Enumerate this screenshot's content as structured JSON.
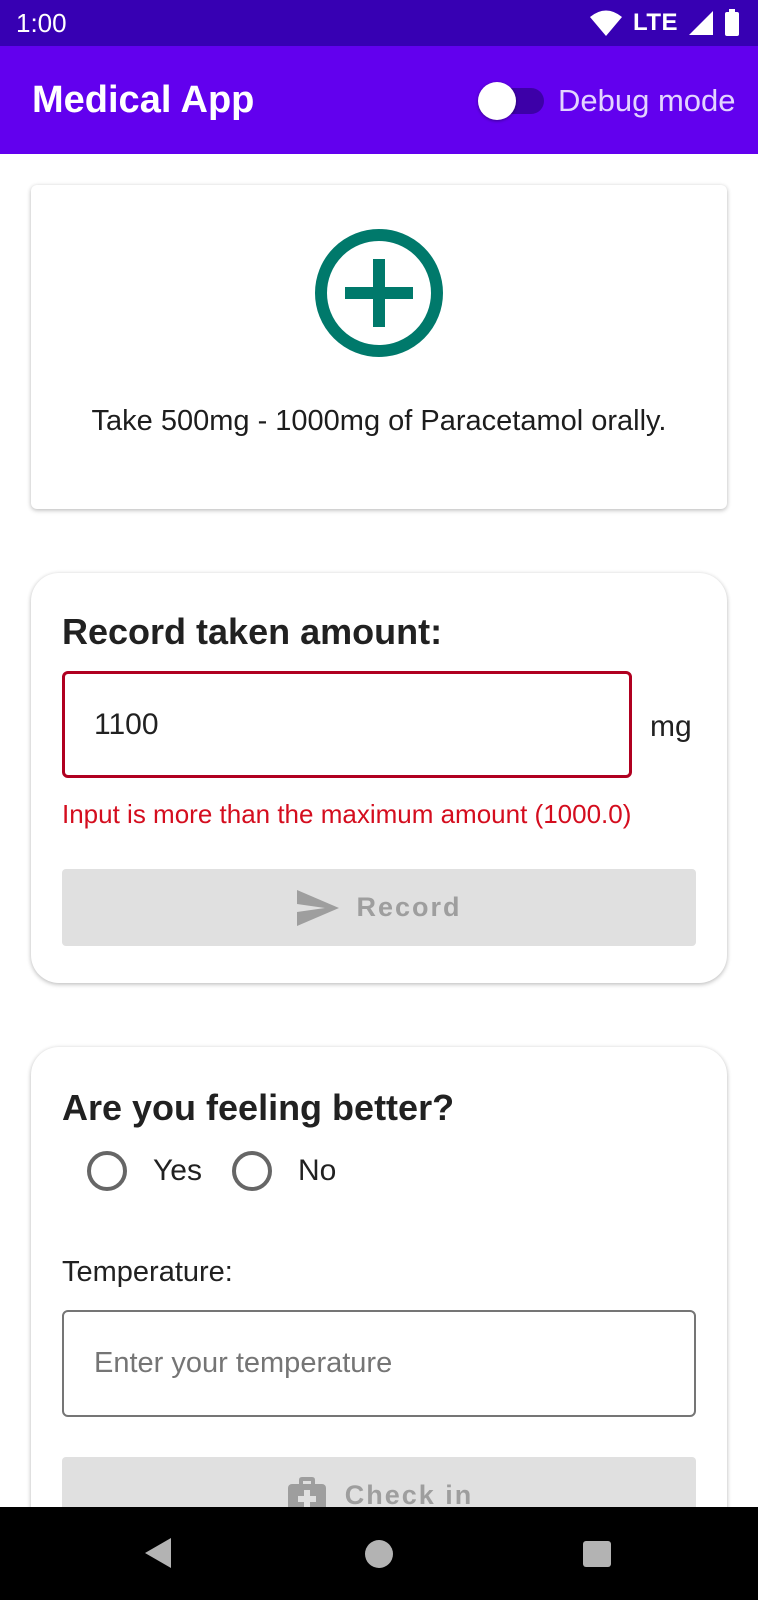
{
  "status_bar": {
    "time": "1:00",
    "network": "LTE",
    "icons": [
      "wifi-icon",
      "signal-icon",
      "battery-icon"
    ]
  },
  "app_bar": {
    "title": "Medical App",
    "debug_label": "Debug mode",
    "debug_enabled": false,
    "color": "#6200ee"
  },
  "instruction_card": {
    "icon": "add-circle-icon",
    "icon_color": "#00796b",
    "text": "Take 500mg - 1000mg of Paracetamol orally."
  },
  "record_card": {
    "title": "Record taken amount:",
    "amount_value": "1100",
    "unit": "mg",
    "error": "Input is more than the maximum amount (1000.0)",
    "error_color": "#d40d1e",
    "button_label": "Record",
    "button_icon": "send-icon",
    "button_enabled": false
  },
  "feeling_card": {
    "title": "Are you feeling better?",
    "options": [
      "Yes",
      "No"
    ],
    "selected_option": null,
    "temperature_label": "Temperature:",
    "temperature_placeholder": "Enter your temperature",
    "temperature_value": "",
    "button_label": "Check in",
    "button_icon": "medical-bag-icon",
    "button_enabled": false
  },
  "nav_bar": {
    "buttons": [
      "back-icon",
      "home-icon",
      "recents-icon"
    ]
  }
}
